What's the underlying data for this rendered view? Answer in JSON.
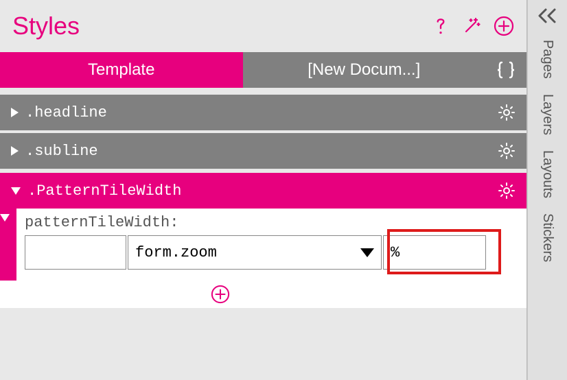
{
  "header": {
    "title": "Styles"
  },
  "tabs": {
    "template": "Template",
    "doc": "[New Docum...]"
  },
  "styles": {
    "headline": ".headline",
    "subline": ".subline",
    "patternTileWidth": ".PatternTileWidth"
  },
  "property": {
    "name": "patternTileWidth:",
    "valueA": "",
    "select": "form.zoom",
    "unit": "%"
  },
  "side": {
    "pages": "Pages",
    "layers": "Layers",
    "layouts": "Layouts",
    "stickers": "Stickers"
  }
}
